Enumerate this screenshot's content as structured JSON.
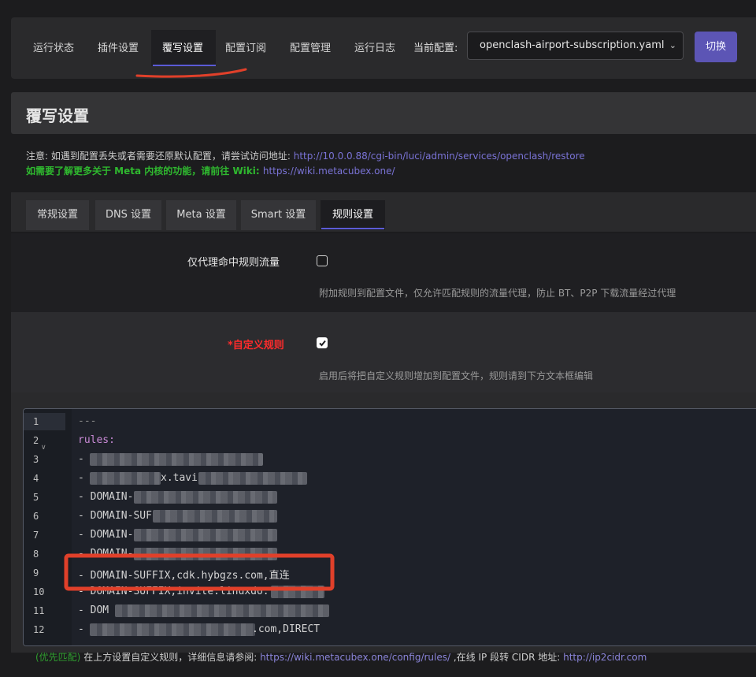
{
  "topnav": {
    "tabs": [
      {
        "label": "运行状态"
      },
      {
        "label": "插件设置"
      },
      {
        "label": "覆写设置",
        "active": true
      },
      {
        "label": "配置订阅"
      },
      {
        "label": "配置管理"
      },
      {
        "label": "运行日志"
      }
    ],
    "current_config_label": "当前配置:",
    "current_config_value": "openclash-airport-subscription.yaml",
    "switch_label": "切换"
  },
  "page": {
    "title": "覆写设置",
    "note_line1": "注意: 如遇到配置丢失或者需要还原默认配置，请尝试访问地址: ",
    "note_line1_link": "http://10.0.0.88/cgi-bin/luci/admin/services/openclash/restore",
    "note_line2": "如需要了解更多关于 Meta 内核的功能，请前往 Wiki: ",
    "note_line2_link": "https://wiki.metacubex.one/"
  },
  "subtabs": [
    {
      "label": "常规设置"
    },
    {
      "label": "DNS 设置"
    },
    {
      "label": "Meta 设置"
    },
    {
      "label": "Smart 设置"
    },
    {
      "label": "规则设置",
      "active": true
    }
  ],
  "settings": {
    "proxy_rule_only": {
      "label": "仅代理命中规则流量",
      "checked": false,
      "desc": "附加规则到配置文件，仅允许匹配规则的流量代理，防止 BT、P2P 下载流量经过代理"
    },
    "custom_rules": {
      "label": "*自定义规则",
      "checked": true,
      "desc": "启用后将把自定义规则增加到配置文件，规则请到下方文本框编辑"
    }
  },
  "editor": {
    "line_numbers": [
      "1",
      "2",
      "3",
      "4",
      "5",
      "6",
      "7",
      "8",
      "9",
      "10",
      "11",
      "12"
    ],
    "lines": [
      "---",
      "rules:",
      "- ",
      "- ",
      "- DOMAIN-",
      "- DOMAIN-SUF",
      "- DOMAIN-",
      "- DOMAIN-",
      "- DOMAIN-SUFFIX,cdk.hybgzs.com,直连",
      "- DOMAIN-SUFFIX,invite.linuxdo.",
      "- DOM",
      "- "
    ],
    "line4_tail": "x.tavi",
    "line12_tail": ".com,DIRECT"
  },
  "footnote": {
    "tag": "(优先匹配)",
    "text1": " 在上方设置自定义规则，详细信息请参阅: ",
    "link1": "https://wiki.metacubex.one/config/rules/",
    "text2": " ,在线 IP 段转 CIDR 地址: ",
    "link2": "http://ip2cidr.com"
  },
  "colors": {
    "accent": "#5c55b5",
    "annotation_red": "#e0402a",
    "success_green": "#2fb82f",
    "required_red": "#ff2b2b"
  }
}
